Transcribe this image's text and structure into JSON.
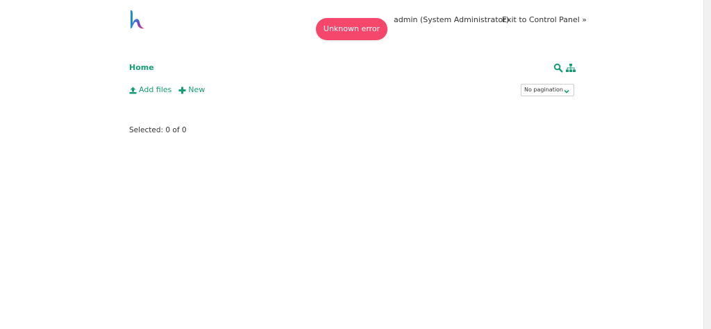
{
  "header": {
    "error_message": "Unknown error",
    "user_label": "admin (System Administrator)",
    "exit_label": "Exit to Control Panel »"
  },
  "breadcrumb": {
    "home_label": "Home"
  },
  "toolbar": {
    "add_files_label": "Add files",
    "new_label": "New",
    "pagination_selected": "No pagination"
  },
  "status": {
    "selected_text": "Selected: 0 of 0"
  },
  "icons": {
    "logo": "brand-logo",
    "search": "search-icon",
    "sitemap": "sitemap-icon",
    "upload": "upload-icon",
    "plus": "plus-icon",
    "chevron": "chevron-down-icon"
  },
  "colors": {
    "accent": "#159e73",
    "error": "#f5476b",
    "text": "#333333"
  }
}
